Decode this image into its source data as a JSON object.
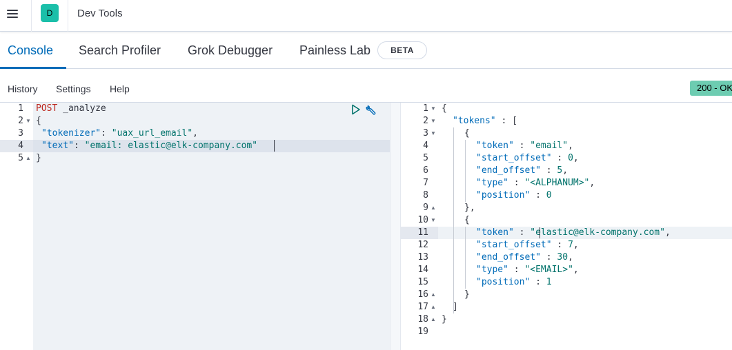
{
  "header": {
    "space_initial": "D",
    "app_title": "Dev Tools"
  },
  "tabs": [
    {
      "label": "Console",
      "active": true
    },
    {
      "label": "Search Profiler",
      "active": false
    },
    {
      "label": "Grok Debugger",
      "active": false
    },
    {
      "label": "Painless Lab",
      "active": false
    }
  ],
  "beta_badge": "BETA",
  "submenu": {
    "history": "History",
    "settings": "Settings",
    "help": "Help"
  },
  "status_badge": "200 - OK",
  "request_editor": {
    "line_numbers": [
      "1",
      "2",
      "3",
      "4",
      "5"
    ],
    "lines": [
      {
        "method": "POST",
        "path": " _analyze"
      },
      {
        "text": "{"
      },
      {
        "key": "\"tokenizer\"",
        "sep": ": ",
        "value": "\"uax_url_email\"",
        "end": ","
      },
      {
        "key": "\"text\"",
        "sep": ": ",
        "value": "\"email: elastic@elk-company.com\"",
        "end": ""
      },
      {
        "text": "}"
      }
    ]
  },
  "response_editor": {
    "line_numbers": [
      "1",
      "2",
      "3",
      "4",
      "5",
      "6",
      "7",
      "8",
      "9",
      "10",
      "11",
      "12",
      "13",
      "14",
      "15",
      "16",
      "17",
      "18",
      "19"
    ],
    "lines": [
      {
        "text": "{"
      },
      {
        "key": "\"tokens\"",
        "sep": " : ",
        "value": "",
        "end": "["
      },
      {
        "text": "{"
      },
      {
        "key": "\"token\"",
        "sep": " : ",
        "value": "\"email\"",
        "end": ","
      },
      {
        "key": "\"start_offset\"",
        "sep": " : ",
        "value": "0",
        "end": ","
      },
      {
        "key": "\"end_offset\"",
        "sep": " : ",
        "value": "5",
        "end": ","
      },
      {
        "key": "\"type\"",
        "sep": " : ",
        "value": "\"<ALPHANUM>\"",
        "end": ","
      },
      {
        "key": "\"position\"",
        "sep": " : ",
        "value": "0",
        "end": ""
      },
      {
        "text": "},"
      },
      {
        "text": "{"
      },
      {
        "key": "\"token\"",
        "sep": " : ",
        "value": "\"elastic@elk-company.com\"",
        "end": ","
      },
      {
        "key": "\"start_offset\"",
        "sep": " : ",
        "value": "7",
        "end": ","
      },
      {
        "key": "\"end_offset\"",
        "sep": " : ",
        "value": "30",
        "end": ","
      },
      {
        "key": "\"type\"",
        "sep": " : ",
        "value": "\"<EMAIL>\"",
        "end": ","
      },
      {
        "key": "\"position\"",
        "sep": " : ",
        "value": "1",
        "end": ""
      },
      {
        "text": "}"
      },
      {
        "text": "]"
      },
      {
        "text": "}"
      },
      {
        "text": ""
      }
    ]
  },
  "colors": {
    "accent": "#006bb8",
    "status_ok": "#6dccb1",
    "space_avatar": "#1bbfa9",
    "json_key": "#006bb8",
    "json_string": "#00726b",
    "http_method": "#bd271e"
  },
  "icons": {
    "menu": "hamburger-menu-icon",
    "run": "play-icon",
    "actions": "wrench-icon",
    "fold_open": "fold-open-icon",
    "fold_closed": "fold-close-icon"
  }
}
